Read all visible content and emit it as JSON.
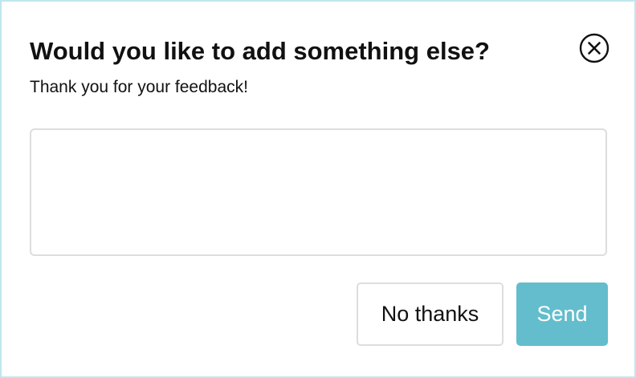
{
  "dialog": {
    "title": "Would you like to add something else?",
    "subtitle": "Thank you for your feedback!",
    "close_icon": "close-circle-icon",
    "feedback_input": {
      "value": "",
      "placeholder": ""
    },
    "buttons": {
      "no_thanks_label": "No thanks",
      "send_label": "Send"
    }
  },
  "colors": {
    "dialog_border": "#bfe6ee",
    "send_button": "#63bdcc",
    "text": "#111111",
    "input_border": "#dddddd"
  }
}
